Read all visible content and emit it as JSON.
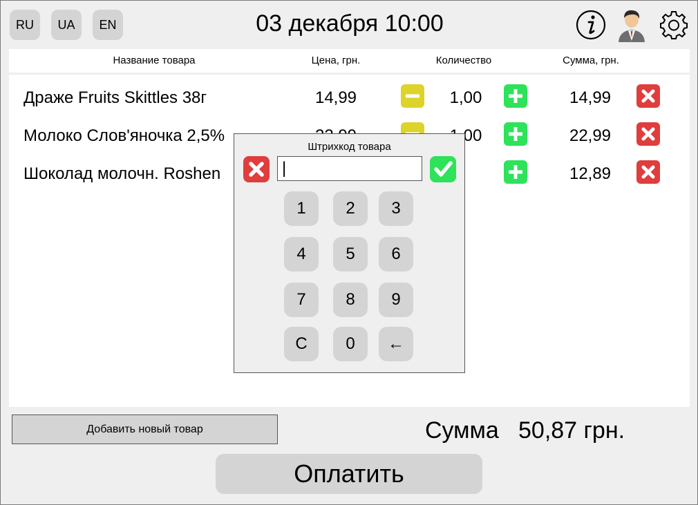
{
  "header": {
    "languages": [
      "RU",
      "UA",
      "EN"
    ],
    "datetime": "03 декабря 10:00",
    "icons": [
      "info-icon",
      "user-avatar-icon",
      "gear-icon"
    ]
  },
  "table": {
    "columns": [
      "Название товара",
      "Цена, грн.",
      "Количество",
      "Сумма, грн."
    ],
    "rows": [
      {
        "name": "Драже Fruits Skittles 38г",
        "price": "14,99",
        "qty": "1,00",
        "sum": "14,99"
      },
      {
        "name": "Молоко Слов'яночка 2,5%",
        "price": "22,99",
        "qty": "1,00",
        "sum": "22,99"
      },
      {
        "name": "Шоколад молочн. Roshen",
        "price": "",
        "qty": "",
        "sum": "12,89"
      }
    ]
  },
  "footer": {
    "add_label": "Добавить новый товар",
    "total_label": "Сумма",
    "total_value": "50,87 грн.",
    "pay_label": "Оплатить"
  },
  "dialog": {
    "title": "Штрихкод товара",
    "input_value": "|",
    "keys": [
      "1",
      "2",
      "3",
      "4",
      "5",
      "6",
      "7",
      "8",
      "9",
      "C",
      "0",
      "←"
    ]
  },
  "colors": {
    "minus": "#ddd32a",
    "plus": "#2ee25a",
    "delete": "#e03d3d",
    "button": "#d4d4d4",
    "background": "#efefef"
  }
}
